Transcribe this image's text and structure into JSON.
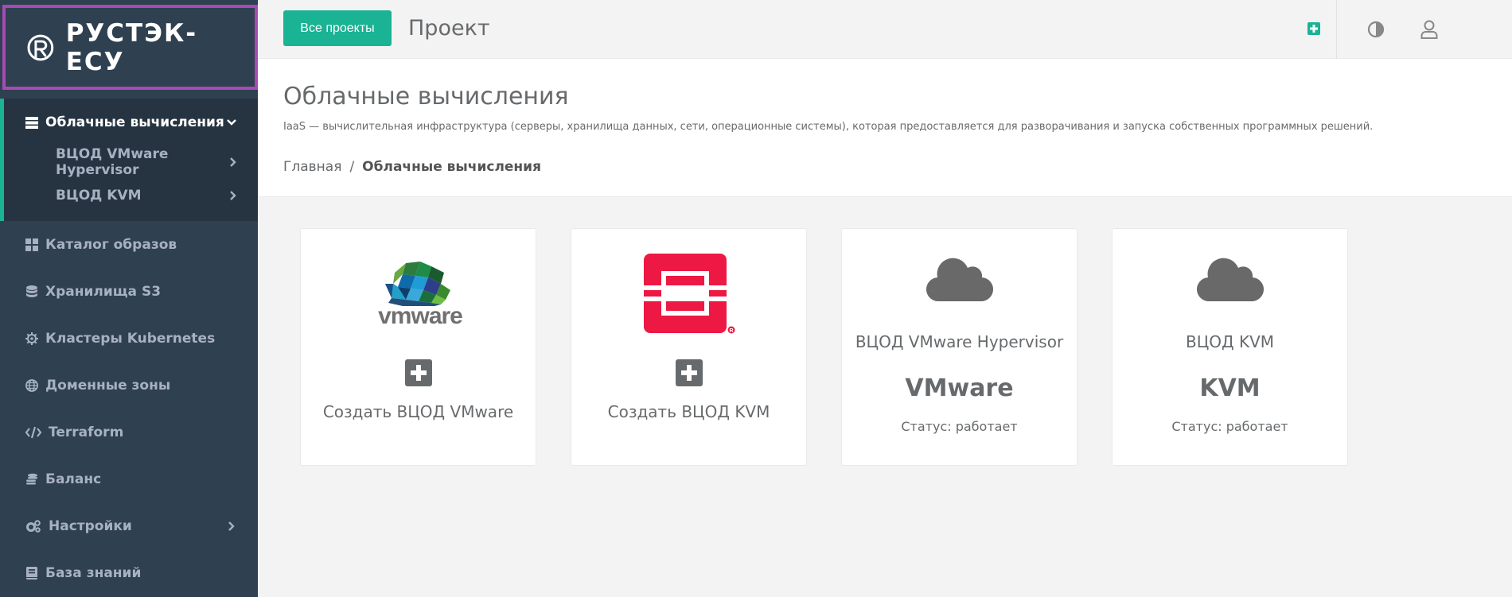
{
  "brand": {
    "name": "РУСТЭК-ЕСУ"
  },
  "sidebar": {
    "items": [
      {
        "label": "Облачные вычисления",
        "icon": "server-icon",
        "expanded": true
      },
      {
        "label": "ВЦОД VMware Hypervisor",
        "sub": true
      },
      {
        "label": "ВЦОД KVM",
        "sub": true
      },
      {
        "label": "Каталог образов",
        "icon": "grid-icon"
      },
      {
        "label": "Хранилища S3",
        "icon": "database-icon"
      },
      {
        "label": "Кластеры Kubernetes",
        "icon": "helm-icon"
      },
      {
        "label": "Доменные зоны",
        "icon": "globe-icon"
      },
      {
        "label": "Terraform",
        "icon": "code-icon"
      },
      {
        "label": "Баланс",
        "icon": "coins-icon"
      },
      {
        "label": "Настройки",
        "icon": "cogs-icon"
      },
      {
        "label": "База знаний",
        "icon": "book-icon"
      }
    ]
  },
  "topbar": {
    "all_projects_label": "Все проекты",
    "project_title": "Проект"
  },
  "header": {
    "title": "Облачные вычисления",
    "description": "IaaS — вычислительная инфраструктура (серверы, хранилища данных, сети, операционные системы), которая предоставляется для разворачивания и запуска собственных программных решений.",
    "breadcrumb": {
      "home": "Главная",
      "separator": "/",
      "current": "Облачные вычисления"
    }
  },
  "cards": [
    {
      "logo": "vmware-logo",
      "logo_text": "vmware",
      "action": "Создать ВЦОД VMware"
    },
    {
      "logo": "openstack-logo",
      "action": "Создать ВЦОД KVM"
    },
    {
      "icon": "cloud-icon",
      "title": "ВЦОД VMware Hypervisor",
      "type": "VMware",
      "status": "Статус: работает"
    },
    {
      "icon": "cloud-icon",
      "title": "ВЦОД KVM",
      "type": "KVM",
      "status": "Статус: работает"
    }
  ],
  "colors": {
    "accent": "#1ab394",
    "sidebar": "#2f4050",
    "highlight": "#a74ab2",
    "openstack": "#ed1944"
  }
}
